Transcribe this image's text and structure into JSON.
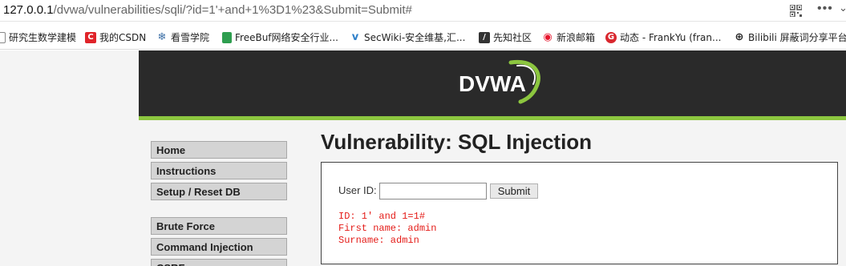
{
  "browser": {
    "url_host": "127.0.0.1",
    "url_path": "/dvwa/vulnerabilities/sqli/?id=1'+and+1%3D1%23&Submit=Submit#"
  },
  "bookmarks": [
    {
      "label": "研究生数学建模",
      "icon": "bookmark-folder-icon",
      "color": "#555555"
    },
    {
      "label": "我的CSDN",
      "icon": "csdn-icon",
      "color": "#e0242a"
    },
    {
      "label": "看雪学院",
      "icon": "snowflake-icon",
      "color": "#3b6ea5"
    },
    {
      "label": "FreeBuf网络安全行业...",
      "icon": "freebuf-icon",
      "color": "#2e9e4f"
    },
    {
      "label": "SecWiki-安全维基,汇...",
      "icon": "secwiki-icon",
      "color": "#2f80c9"
    },
    {
      "label": "先知社区",
      "icon": "xianzhi-icon",
      "color": "#333333"
    },
    {
      "label": "新浪邮箱",
      "icon": "sina-icon",
      "color": "#e6162d"
    },
    {
      "label": "动态 - FrankYu (fran...",
      "icon": "ruanyou-icon",
      "color": "#d9272e"
    },
    {
      "label": "Bilibili 屏蔽词分享平台",
      "icon": "globe-icon",
      "color": "#222222"
    }
  ],
  "dvwa": {
    "logo_text": "DVWA",
    "menu": [
      "Home",
      "Instructions",
      "Setup / Reset DB",
      "Brute Force",
      "Command Injection",
      "CSRF"
    ],
    "page_title": "Vulnerability: SQL Injection",
    "form": {
      "user_id_label": "User ID:",
      "user_id_value": "",
      "submit_label": "Submit"
    },
    "result": {
      "id_line": "ID: 1' and 1=1#",
      "first_name_line": "First name: admin",
      "surname_line": "Surname: admin"
    }
  },
  "colors": {
    "header_bg": "#2a2a2a",
    "accent_green": "#8cc63f",
    "result_red": "#e41b17"
  }
}
